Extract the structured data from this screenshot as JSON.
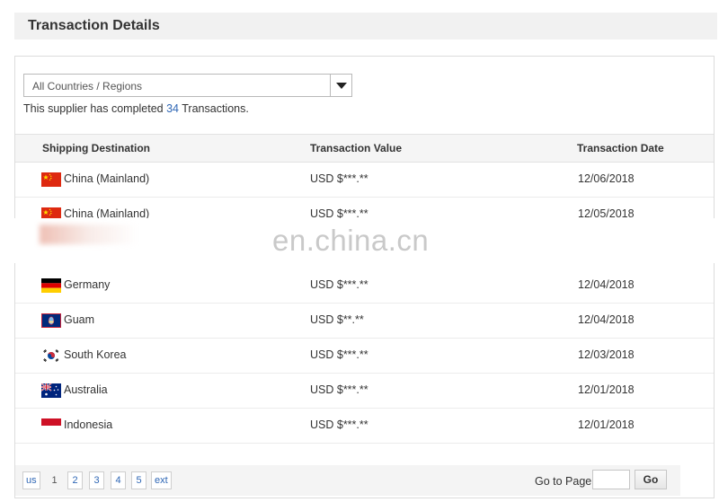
{
  "header": {
    "title": "Transaction Details"
  },
  "filter": {
    "selected": "All Countries / Regions"
  },
  "summary": {
    "prefix": "This supplier has completed ",
    "count": "34",
    "suffix": " Transactions."
  },
  "table": {
    "columns": [
      "Shipping Destination",
      "Transaction Value",
      "Transaction Date"
    ],
    "rows": [
      {
        "country": "China (Mainland)",
        "flag": "china-flag-icon",
        "value": "USD $***.**",
        "date": "12/06/2018"
      },
      {
        "country": "China (Mainland)",
        "flag": "china-flag-icon",
        "value": "USD $***.**",
        "date": "12/05/2018"
      },
      {
        "country": "Germany",
        "flag": "germany-flag-icon",
        "value": "USD $***.**",
        "date": "12/04/2018"
      },
      {
        "country": "Guam",
        "flag": "guam-flag-icon",
        "value": "USD $**.**",
        "date": "12/04/2018"
      },
      {
        "country": "South Korea",
        "flag": "south-korea-flag-icon",
        "value": "USD $***.**",
        "date": "12/03/2018"
      },
      {
        "country": "Australia",
        "flag": "australia-flag-icon",
        "value": "USD $***.**",
        "date": "12/01/2018"
      },
      {
        "country": "Indonesia",
        "flag": "indonesia-flag-icon",
        "value": "USD $***.**",
        "date": "12/01/2018"
      }
    ]
  },
  "watermark": "en.china.cn",
  "pagination": {
    "prev_label": "us",
    "current_page": "1",
    "pages": [
      "2",
      "3",
      "4",
      "5"
    ],
    "next_label": "ext",
    "goto_label": "Go to Page",
    "goto_value": "",
    "go_label": "Go"
  },
  "colors": {
    "link": "#2f67b5",
    "header_bg": "#f1f1f1",
    "table_head_bg": "#f5f5f5"
  }
}
